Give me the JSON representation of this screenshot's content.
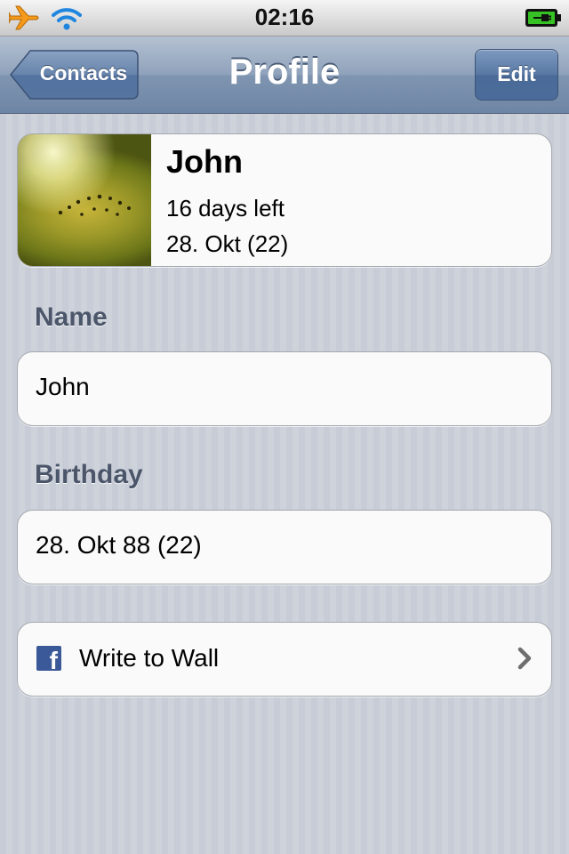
{
  "status_bar": {
    "time": "02:16",
    "icons": [
      "airplane-icon",
      "wifi-icon",
      "battery-charging-icon"
    ]
  },
  "nav": {
    "back_label": "Contacts",
    "title": "Profile",
    "edit_label": "Edit"
  },
  "profile": {
    "name": "John",
    "days_left": "16 days left",
    "date": "28. Okt (22)"
  },
  "name_section": {
    "label": "Name",
    "value": "John"
  },
  "birthday_section": {
    "label": "Birthday",
    "value": "28. Okt 88 (22)"
  },
  "wall_action": {
    "label": "Write to Wall",
    "icon": "facebook-icon"
  },
  "colors": {
    "nav_bar": "#7f95b1",
    "edit_button": "#4a6b98",
    "section_label": "#4c566a",
    "facebook": "#3b5998"
  }
}
